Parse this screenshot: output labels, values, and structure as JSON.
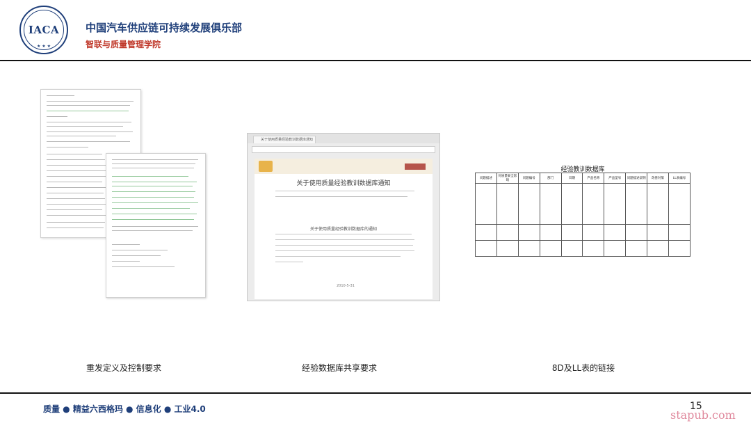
{
  "header": {
    "logo_text": "IACA",
    "org_title": "中国汽车供应链可持续发展俱乐部",
    "org_subtitle": "智联与质量管理学院"
  },
  "figures": {
    "browser": {
      "tab_title": "关于使用质量经验教训数据库通知",
      "page_title": "关于使用质量经验教训数据库通知",
      "body_title": "关于使用质量经验教训数据库的通知",
      "date": "2010-5-31"
    },
    "database": {
      "title": "经验教训数据库",
      "columns": [
        "问题描述",
        "对质量安全影响",
        "问题编号",
        "部门",
        "日期",
        "产品名称",
        "产品型号",
        "问题描述说明",
        "改善对策",
        "LL表编号"
      ]
    }
  },
  "captions": {
    "left": "重发定义及控制要求",
    "middle": "经验数据库共享要求",
    "right": "8D及LL表的链接"
  },
  "footer": {
    "tagline": "质量 ● 精益六西格玛 ● 信息化 ● 工业4.0",
    "page_number": "15",
    "watermark": "stapub.com"
  }
}
